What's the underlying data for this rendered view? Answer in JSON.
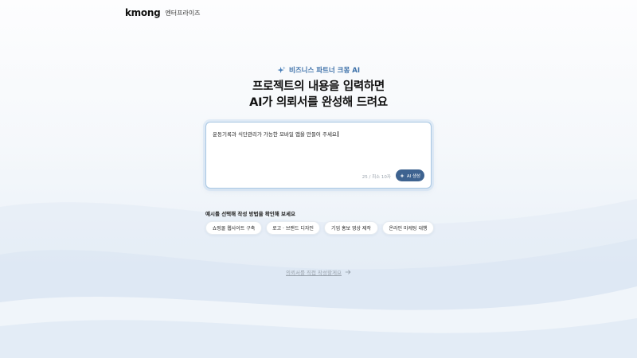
{
  "header": {
    "logo": "kmong",
    "logo_sub": "엔터프라이즈"
  },
  "hero": {
    "eyebrow": "비즈니스 파트너 크몽 AI",
    "title_line1": "프로젝트의 내용을 입력하면",
    "title_line2": "AI가 의뢰서를 완성해 드려요"
  },
  "prompt": {
    "value": "운동기록과 식단관리가 가능한 모바일 앱을 만들어 주세요",
    "char_count": "25 / 최소 10자",
    "generate_label": "AI 생성"
  },
  "examples": {
    "label": "예시를 선택해 작성 방법을 확인해 보세요",
    "chips": [
      "쇼핑몰 웹사이트 구축",
      "로고 · 브랜드 디자인",
      "기업 홍보 영상 제작",
      "온라인 마케팅 대행"
    ]
  },
  "manual": {
    "label": "의뢰서를 직접 작성할게요"
  },
  "colors": {
    "accent": "#3e6390",
    "border": "#a9c8e3",
    "eyebrow": "#3b6fa8"
  }
}
